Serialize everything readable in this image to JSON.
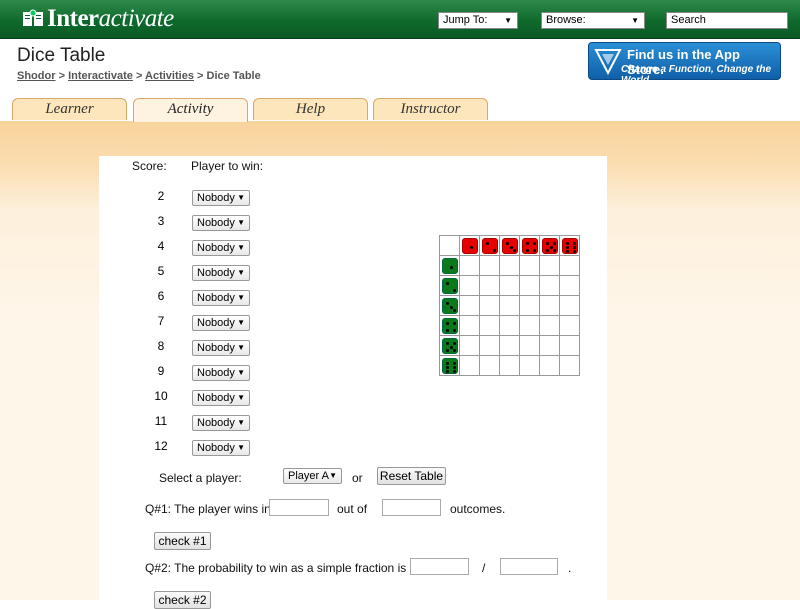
{
  "header": {
    "logo_text_bold": "Inter",
    "logo_text_italic": "activate",
    "jump_to_label": "Jump To:",
    "browse_label": "Browse:",
    "search_label": "Search"
  },
  "page": {
    "title": "Dice Table",
    "breadcrumb": [
      "Shodor",
      "Interactivate",
      "Activities",
      "Dice Table"
    ],
    "breadcrumb_sep": ">"
  },
  "appstore": {
    "line1": "Find us in the App Store.",
    "line2": "Change a Function, Change the World"
  },
  "tabs": [
    {
      "label": "Learner",
      "active": false
    },
    {
      "label": "Activity",
      "active": true
    },
    {
      "label": "Help",
      "active": false
    },
    {
      "label": "Instructor",
      "active": false
    }
  ],
  "table": {
    "score_header": "Score:",
    "player_header": "Player to win:",
    "rows": [
      {
        "score": "2",
        "winner": "Nobody"
      },
      {
        "score": "3",
        "winner": "Nobody"
      },
      {
        "score": "4",
        "winner": "Nobody"
      },
      {
        "score": "5",
        "winner": "Nobody"
      },
      {
        "score": "6",
        "winner": "Nobody"
      },
      {
        "score": "7",
        "winner": "Nobody"
      },
      {
        "score": "8",
        "winner": "Nobody"
      },
      {
        "score": "9",
        "winner": "Nobody"
      },
      {
        "score": "10",
        "winner": "Nobody"
      },
      {
        "score": "11",
        "winner": "Nobody"
      },
      {
        "score": "12",
        "winner": "Nobody"
      }
    ]
  },
  "controls": {
    "select_player_label": "Select a player:",
    "player_value": "Player A",
    "or_label": "or",
    "reset_label": "Reset Table"
  },
  "questions": {
    "q1_prefix": "Q#1: The player wins in",
    "q1_mid": "out of",
    "q1_suffix": "outcomes.",
    "q1_button": "check #1",
    "q2_prefix": "Q#2: The probability to win as a simple fraction is",
    "q2_sep": "/",
    "q2_suffix": ".",
    "q2_button": "check #2"
  },
  "dice": {
    "top_values": [
      1,
      2,
      3,
      4,
      5,
      6
    ],
    "side_values": [
      1,
      2,
      3,
      4,
      5,
      6
    ],
    "top_color": "#e60000",
    "side_color": "#0a7a1a"
  }
}
